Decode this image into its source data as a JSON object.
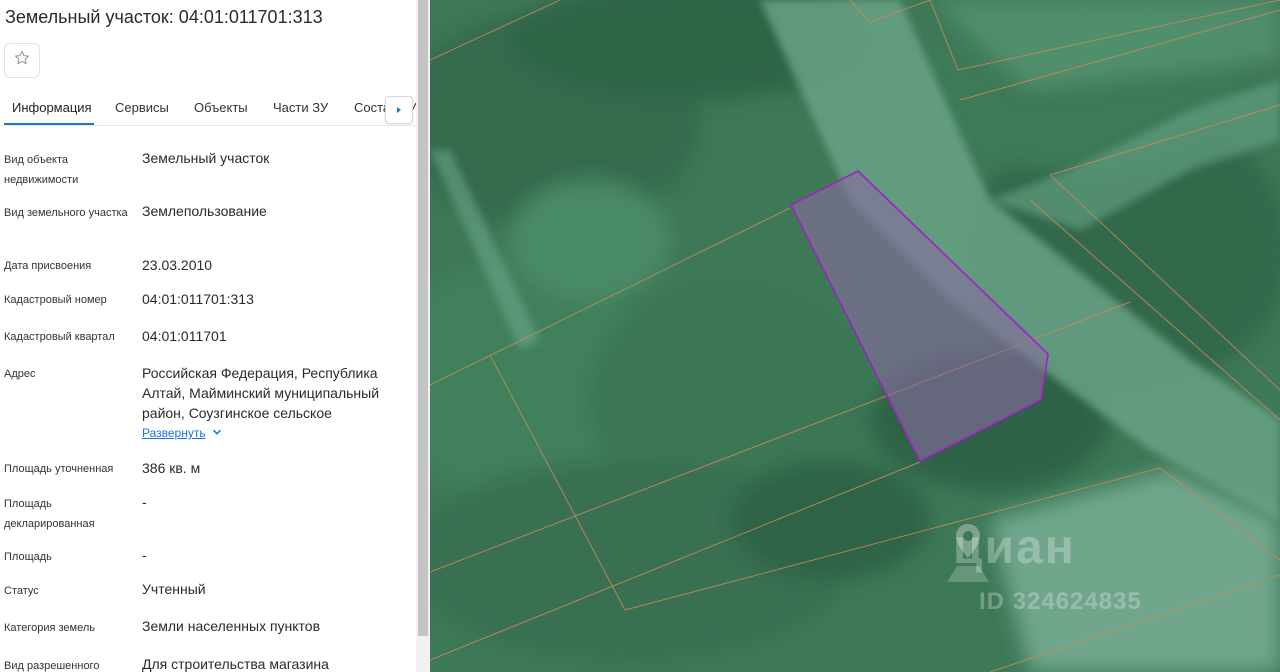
{
  "panel": {
    "title": "Земельный участок: 04:01:011701:313",
    "favorite_icon": "star-outline-icon",
    "tabs": [
      {
        "label": "Информация",
        "active": true
      },
      {
        "label": "Сервисы",
        "active": false
      },
      {
        "label": "Объекты",
        "active": false
      },
      {
        "label": "Части ЗУ",
        "active": false
      },
      {
        "label": "Состав ЗУ",
        "active": false
      }
    ],
    "tab_scroll_icon": "chevron-right-icon",
    "fields": [
      {
        "label": "Вид объекта недвижимости",
        "value": "Земельный участок"
      },
      {
        "label": "Вид земельного участка",
        "value": "Землепользование"
      },
      {
        "label": "Дата присвоения",
        "value": "23.03.2010"
      },
      {
        "label": "Кадастровый номер",
        "value": "04:01:011701:313"
      },
      {
        "label": "Кадастровый квартал",
        "value": "04:01:011701"
      },
      {
        "label": "Адрес",
        "value": "Российская Федерация, Республика Алтай, Майминский муниципальный район, Соузгинское сельское",
        "expand_label": "Развернуть"
      },
      {
        "label": "Площадь уточненная",
        "value": "386 кв. м"
      },
      {
        "label": "Площадь декларированная",
        "value": "-"
      },
      {
        "label": "Площадь",
        "value": "-"
      },
      {
        "label": "Статус",
        "value": "Учтенный"
      },
      {
        "label": "Категория земель",
        "value": "Земли населенных пунктов"
      },
      {
        "label": "Вид разрешенного использования",
        "value": "Для строительства магазина"
      }
    ]
  },
  "map": {
    "parcel_outline_color": "#a020c8",
    "boundary_color": "#c98a5a",
    "watermark_brand": "циан",
    "watermark_id": "ID 324624835"
  }
}
